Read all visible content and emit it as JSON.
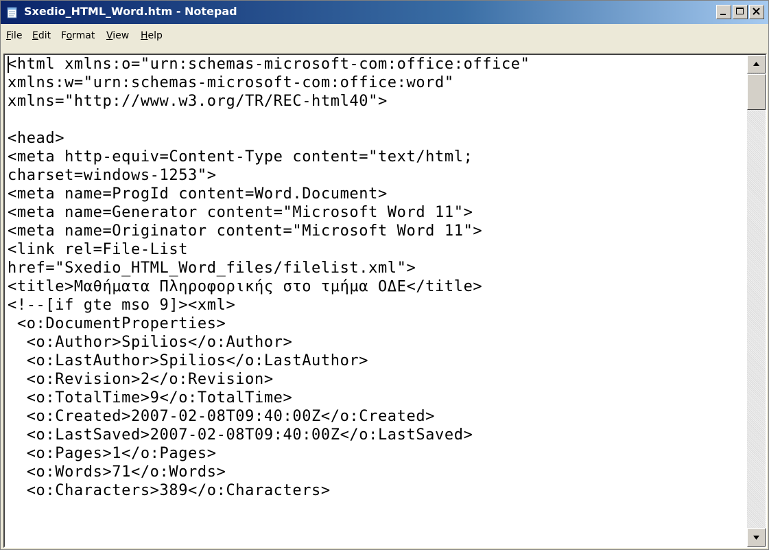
{
  "window": {
    "title": "Sxedio_HTML_Word.htm - Notepad",
    "icon": "notepad-icon"
  },
  "menu": [
    {
      "label_ul": "F",
      "label_rest": "ile"
    },
    {
      "label_ul": "E",
      "label_rest": "dit"
    },
    {
      "label_pre": "F",
      "label_ul": "o",
      "label_rest": "rmat"
    },
    {
      "label_ul": "V",
      "label_rest": "iew"
    },
    {
      "label_ul": "H",
      "label_rest": "elp"
    }
  ],
  "editor": {
    "lines": [
      "<html xmlns:o=\"urn:schemas-microsoft-com:office:office\"",
      "xmlns:w=\"urn:schemas-microsoft-com:office:word\"",
      "xmlns=\"http://www.w3.org/TR/REC-html40\">",
      "",
      "<head>",
      "<meta http-equiv=Content-Type content=\"text/html;",
      "charset=windows-1253\">",
      "<meta name=ProgId content=Word.Document>",
      "<meta name=Generator content=\"Microsoft Word 11\">",
      "<meta name=Originator content=\"Microsoft Word 11\">",
      "<link rel=File-List",
      "href=\"Sxedio_HTML_Word_files/filelist.xml\">",
      "<title>Μαθήματα Πληροφορικής στο τμήμα ΟΔΕ</title>",
      "<!--[if gte mso 9]><xml>",
      " <o:DocumentProperties>",
      "  <o:Author>Spilios</o:Author>",
      "  <o:LastAuthor>Spilios</o:LastAuthor>",
      "  <o:Revision>2</o:Revision>",
      "  <o:TotalTime>9</o:TotalTime>",
      "  <o:Created>2007-02-08T09:40:00Z</o:Created>",
      "  <o:LastSaved>2007-02-08T09:40:00Z</o:LastSaved>",
      "  <o:Pages>1</o:Pages>",
      "  <o:Words>71</o:Words>",
      "  <o:Characters>389</o:Characters>"
    ]
  }
}
